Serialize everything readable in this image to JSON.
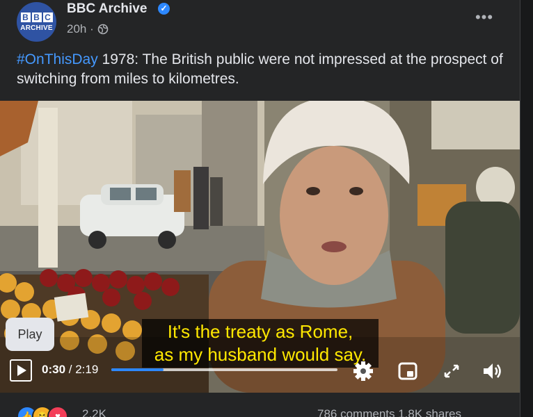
{
  "post": {
    "page_name": "BBC Archive",
    "avatar_text": {
      "letters": [
        "B",
        "B",
        "C"
      ],
      "sub": "ARCHIVE"
    },
    "time": "20h ·",
    "caption_hashtag": "#OnThisDay",
    "caption_text": " 1978: The British public were not impressed at the prospect of switching from miles to kilometres."
  },
  "video": {
    "tooltip": "Play",
    "subtitle_line1": "It's the treaty as Rome,",
    "subtitle_line2": "as my husband would say.",
    "time_current": "0:30",
    "time_separator": " / ",
    "time_total": "2:19",
    "progress_fraction": 0.23
  },
  "footer": {
    "reaction_count": "2.2K",
    "stats": "786 comments  1.8K shares"
  },
  "colors": {
    "accent": "#2d88ff",
    "hashtag": "#4599ff",
    "subtitle_text": "#ffe800",
    "card_bg": "#242526"
  }
}
